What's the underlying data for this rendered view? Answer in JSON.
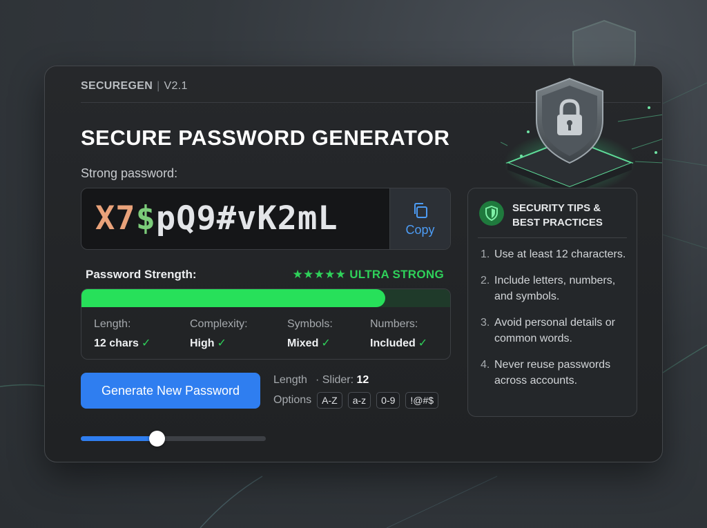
{
  "app": {
    "name": "SECUREGEN",
    "version": "V2.1"
  },
  "title": "SECURE PASSWORD GENERATOR",
  "password": {
    "label": "Strong password:",
    "part1": "X7",
    "part2": "$",
    "part3": "pQ9#vK2mL"
  },
  "copy": {
    "label": "Copy",
    "icon": "copy-icon"
  },
  "strength": {
    "label": "Password Strength:",
    "stars": "★★★★★",
    "rating": "ULTRA STRONG",
    "fill_fraction": 0.82,
    "stats": [
      {
        "label": "Length:",
        "value": "12 chars"
      },
      {
        "label": "Complexity:",
        "value": "High"
      },
      {
        "label": "Symbols:",
        "value": "Mixed"
      },
      {
        "label": "Numbers:",
        "value": "Included"
      }
    ],
    "check": "✓"
  },
  "generate": {
    "label": "Generate New Password"
  },
  "length": {
    "label": "Length",
    "slider_label": "· Slider:",
    "value": "12",
    "slider_fraction": 0.41
  },
  "options": {
    "label": "Options",
    "chips": [
      "A-Z",
      "a-z",
      "0-9",
      "!@#$"
    ]
  },
  "tips": {
    "icon": "shield-icon",
    "title": "SECURITY TIPS & BEST PRACTICES",
    "items": [
      {
        "n": "1.",
        "text": "Use at least 12 characters."
      },
      {
        "n": "2.",
        "text": "Include letters, numbers, and symbols."
      },
      {
        "n": "3.",
        "text": "Avoid personal details or common words."
      },
      {
        "n": "4.",
        "text": "Never reuse passwords across accounts."
      }
    ]
  },
  "colors": {
    "accent_blue": "#2f7ef0",
    "strength_green": "#27e05a",
    "pw_orange": "#e9a27a",
    "pw_green": "#7ccc7a"
  }
}
